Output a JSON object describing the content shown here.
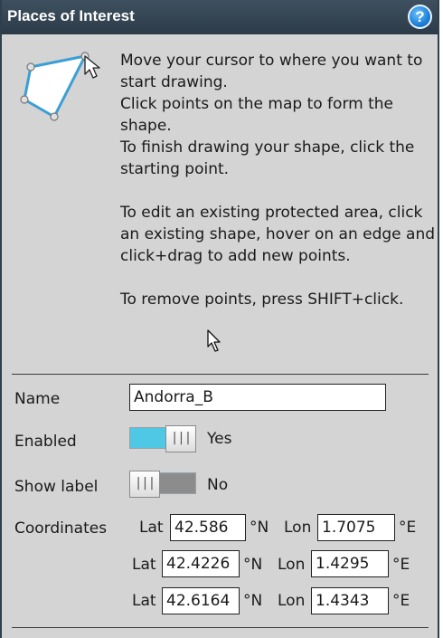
{
  "panel": {
    "title": "Places of Interest",
    "help_icon": "help-icon",
    "help_glyph": "?"
  },
  "instructions": [
    "Move your cursor to where you want to start drawing.",
    "Click points on the map to form the shape.",
    "To finish drawing your shape, click the starting point.",
    "To edit an existing protected area, click an existing shape, hover on an edge and click+drag to add new points.",
    "To remove points, press SHIFT+click."
  ],
  "form": {
    "name_label": "Name",
    "name_value": "Andorra_B",
    "enabled_label": "Enabled",
    "enabled_state": "Yes",
    "enabled_on": true,
    "show_label_label": "Show label",
    "show_label_state": "No",
    "show_label_on": false,
    "knob_grip": "|||",
    "coordinates_label": "Coordinates",
    "lat_label": "Lat",
    "lon_label": "Lon",
    "north_unit": "°N",
    "east_unit": "°E",
    "coordinates": [
      {
        "lat": "42.586",
        "lon": "1.7075"
      },
      {
        "lat": "42.4226",
        "lon": "1.4295"
      },
      {
        "lat": "42.6164",
        "lon": "1.4343"
      }
    ]
  },
  "colors": {
    "title_bar": "#34444f",
    "panel_bg": "#d4d4d4",
    "toggle_on": "#4fc8e6",
    "toggle_off": "#8c8c8c",
    "shape_stroke": "#3a9fd6"
  }
}
